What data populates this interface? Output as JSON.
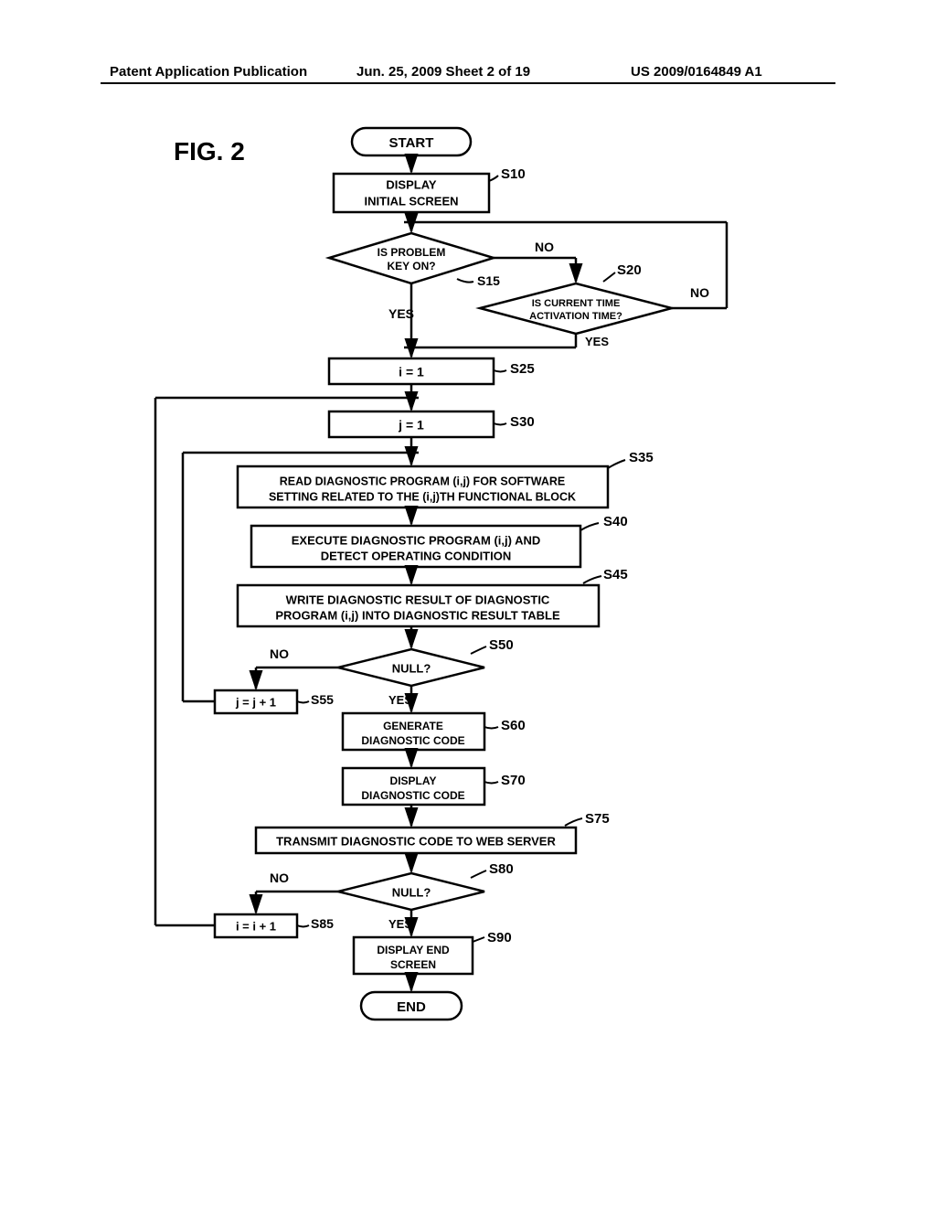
{
  "header": {
    "left": "Patent Application Publication",
    "center": "Jun. 25, 2009  Sheet 2 of 19",
    "right": "US 2009/0164849 A1"
  },
  "figure_label": "FIG. 2",
  "nodes": {
    "start": "START",
    "s10": "DISPLAY\nINITIAL SCREEN",
    "s15": "IS PROBLEM\nKEY ON?",
    "s20": "IS CURRENT TIME\nACTIVATION TIME?",
    "s25": "i = 1",
    "s30": "j = 1",
    "s35": "READ DIAGNOSTIC PROGRAM (i,j) FOR SOFTWARE\nSETTING RELATED TO THE (i,j)TH FUNCTIONAL BLOCK",
    "s40": "EXECUTE DIAGNOSTIC PROGRAM (i,j) AND\nDETECT OPERATING CONDITION",
    "s45": "WRITE DIAGNOSTIC RESULT OF DIAGNOSTIC\nPROGRAM (i,j) INTO DIAGNOSTIC RESULT TABLE",
    "s50": "NULL?",
    "s55": "j = j + 1",
    "s60": "GENERATE\nDIAGNOSTIC CODE",
    "s70": "DISPLAY\nDIAGNOSTIC CODE",
    "s75": "TRANSMIT DIAGNOSTIC CODE TO WEB SERVER",
    "s80": "NULL?",
    "s85": "i = i + 1",
    "s90": "DISPLAY END\nSCREEN",
    "end": "END"
  },
  "step_labels": {
    "s10": "S10",
    "s15": "S15",
    "s20": "S20",
    "s25": "S25",
    "s30": "S30",
    "s35": "S35",
    "s40": "S40",
    "s45": "S45",
    "s50": "S50",
    "s55": "S55",
    "s60": "S60",
    "s70": "S70",
    "s75": "S75",
    "s80": "S80",
    "s85": "S85",
    "s90": "S90"
  },
  "branch_labels": {
    "yes": "YES",
    "no": "NO"
  },
  "chart_data": {
    "type": "flowchart",
    "title": "FIG. 2",
    "nodes": [
      {
        "id": "start",
        "type": "terminator",
        "text": "START"
      },
      {
        "id": "S10",
        "type": "process",
        "text": "DISPLAY INITIAL SCREEN"
      },
      {
        "id": "S15",
        "type": "decision",
        "text": "IS PROBLEM KEY ON?"
      },
      {
        "id": "S20",
        "type": "decision",
        "text": "IS CURRENT TIME ACTIVATION TIME?"
      },
      {
        "id": "S25",
        "type": "process",
        "text": "i = 1"
      },
      {
        "id": "S30",
        "type": "process",
        "text": "j = 1"
      },
      {
        "id": "S35",
        "type": "process",
        "text": "READ DIAGNOSTIC PROGRAM (i,j) FOR SOFTWARE SETTING RELATED TO THE (i,j)TH FUNCTIONAL BLOCK"
      },
      {
        "id": "S40",
        "type": "process",
        "text": "EXECUTE DIAGNOSTIC PROGRAM (i,j) AND DETECT OPERATING CONDITION"
      },
      {
        "id": "S45",
        "type": "process",
        "text": "WRITE DIAGNOSTIC RESULT OF DIAGNOSTIC PROGRAM (i,j) INTO DIAGNOSTIC RESULT TABLE"
      },
      {
        "id": "S50",
        "type": "decision",
        "text": "NULL?"
      },
      {
        "id": "S55",
        "type": "process",
        "text": "j = j + 1"
      },
      {
        "id": "S60",
        "type": "process",
        "text": "GENERATE DIAGNOSTIC CODE"
      },
      {
        "id": "S70",
        "type": "process",
        "text": "DISPLAY DIAGNOSTIC CODE"
      },
      {
        "id": "S75",
        "type": "process",
        "text": "TRANSMIT DIAGNOSTIC CODE TO WEB SERVER"
      },
      {
        "id": "S80",
        "type": "decision",
        "text": "NULL?"
      },
      {
        "id": "S85",
        "type": "process",
        "text": "i = i + 1"
      },
      {
        "id": "S90",
        "type": "process",
        "text": "DISPLAY END SCREEN"
      },
      {
        "id": "end",
        "type": "terminator",
        "text": "END"
      }
    ],
    "edges": [
      {
        "from": "start",
        "to": "S10"
      },
      {
        "from": "S10",
        "to": "S15"
      },
      {
        "from": "S15",
        "to": "S20",
        "label": "NO"
      },
      {
        "from": "S15",
        "to": "S25",
        "label": "YES"
      },
      {
        "from": "S20",
        "to": "S10",
        "label": "NO"
      },
      {
        "from": "S20",
        "to": "S25",
        "label": "YES"
      },
      {
        "from": "S25",
        "to": "S30"
      },
      {
        "from": "S30",
        "to": "S35"
      },
      {
        "from": "S35",
        "to": "S40"
      },
      {
        "from": "S40",
        "to": "S45"
      },
      {
        "from": "S45",
        "to": "S50"
      },
      {
        "from": "S50",
        "to": "S55",
        "label": "NO"
      },
      {
        "from": "S50",
        "to": "S60",
        "label": "YES"
      },
      {
        "from": "S55",
        "to": "S30"
      },
      {
        "from": "S60",
        "to": "S70"
      },
      {
        "from": "S70",
        "to": "S75"
      },
      {
        "from": "S75",
        "to": "S80"
      },
      {
        "from": "S80",
        "to": "S85",
        "label": "NO"
      },
      {
        "from": "S80",
        "to": "S90",
        "label": "YES"
      },
      {
        "from": "S85",
        "to": "S25"
      },
      {
        "from": "S90",
        "to": "end"
      }
    ]
  }
}
